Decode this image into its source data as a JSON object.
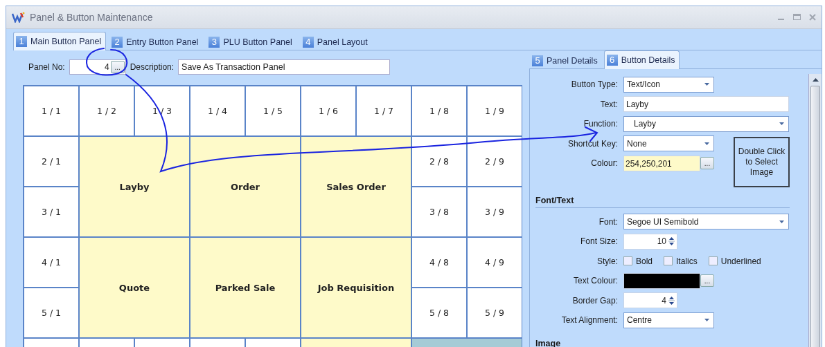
{
  "window": {
    "title": "Panel & Button Maintenance"
  },
  "tabs": [
    {
      "number": "1",
      "label": "Main Button Panel",
      "selected": true
    },
    {
      "number": "2",
      "label": "Entry Button Panel",
      "selected": false
    },
    {
      "number": "3",
      "label": "PLU Button Panel",
      "selected": false
    },
    {
      "number": "4",
      "label": "Panel Layout",
      "selected": false
    }
  ],
  "panel_no": {
    "label": "Panel No:",
    "value": "4",
    "browse": "..."
  },
  "description": {
    "label": "Description:",
    "value": "Save As Transaction Panel"
  },
  "grid": [
    {
      "label": "1 / 1",
      "kind": "single",
      "color": "#ffffff"
    },
    {
      "label": "1 / 2",
      "kind": "single",
      "color": "#ffffff"
    },
    {
      "label": "1 / 3",
      "kind": "single",
      "color": "#ffffff"
    },
    {
      "label": "1 / 4",
      "kind": "single",
      "color": "#ffffff"
    },
    {
      "label": "1 / 5",
      "kind": "single",
      "color": "#ffffff"
    },
    {
      "label": "1 / 6",
      "kind": "single",
      "color": "#ffffff"
    },
    {
      "label": "1 / 7",
      "kind": "single",
      "color": "#ffffff"
    },
    {
      "label": "1 / 8",
      "kind": "single",
      "color": "#ffffff"
    },
    {
      "label": "1 / 9",
      "kind": "single",
      "color": "#ffffff"
    },
    {
      "label": "2 / 1",
      "kind": "single",
      "color": "#ffffff"
    },
    {
      "label": "Layby",
      "kind": "double",
      "color": "#fefac9"
    },
    {
      "label": "Order",
      "kind": "double",
      "color": "#fefac9"
    },
    {
      "label": "Sales Order",
      "kind": "double",
      "color": "#fefac9"
    },
    {
      "label": "2 / 8",
      "kind": "single",
      "color": "#ffffff"
    },
    {
      "label": "2 / 9",
      "kind": "single",
      "color": "#ffffff"
    },
    {
      "label": "3 / 1",
      "kind": "single",
      "color": "#ffffff"
    },
    {
      "label": "3 / 8",
      "kind": "single",
      "color": "#ffffff"
    },
    {
      "label": "3 / 9",
      "kind": "single",
      "color": "#ffffff"
    },
    {
      "label": "4 / 1",
      "kind": "single",
      "color": "#ffffff"
    },
    {
      "label": "Quote",
      "kind": "double",
      "color": "#fefac9"
    },
    {
      "label": "Parked Sale",
      "kind": "double",
      "color": "#fefac9"
    },
    {
      "label": "Job Requisition",
      "kind": "double",
      "color": "#fefac9"
    },
    {
      "label": "4 / 8",
      "kind": "single",
      "color": "#ffffff"
    },
    {
      "label": "4 / 9",
      "kind": "single",
      "color": "#ffffff"
    },
    {
      "label": "5 / 1",
      "kind": "single",
      "color": "#ffffff"
    },
    {
      "label": "5 / 8",
      "kind": "single",
      "color": "#ffffff"
    },
    {
      "label": "5 / 9",
      "kind": "single",
      "color": "#ffffff"
    },
    {
      "kind": "single",
      "color": "#ffffff"
    },
    {
      "kind": "single",
      "color": "#ffffff"
    },
    {
      "kind": "single",
      "color": "#ffffff"
    },
    {
      "kind": "single",
      "color": "#ffffff"
    },
    {
      "kind": "single",
      "color": "#ffffff"
    },
    {
      "kind": "wide",
      "color": "#fefac9"
    },
    {
      "kind": "wide",
      "color": "#a6cbd6"
    }
  ],
  "side_tabs": [
    {
      "number": "5",
      "label": "Panel Details",
      "selected": false
    },
    {
      "number": "6",
      "label": "Button Details",
      "selected": true
    }
  ],
  "fields": [
    {
      "kind": "dropdown",
      "label": "Button Type:",
      "value": "Text/Icon"
    },
    {
      "kind": "text",
      "label": "Text:",
      "value": "Layby"
    },
    {
      "kind": "wide-dropdown",
      "label": "Function:",
      "value": "Layby"
    }
  ],
  "side_fields": [
    {
      "kind": "dropdown",
      "label": "Shortcut Key:",
      "value": "None"
    },
    {
      "kind": "colour",
      "label": "Colour:",
      "value": "254,250,201",
      "browse": "..."
    }
  ],
  "image_box": "Double Click to Select Image",
  "font_section": {
    "title": "Font/Text",
    "fields": [
      {
        "kind": "wide-dropdown",
        "label": "Font:",
        "value": "Segoe UI Semibold"
      },
      {
        "kind": "spinner",
        "label": "Font Size:",
        "value": "10"
      },
      {
        "kind": "checkboxes",
        "label": "Style:",
        "options": [
          {
            "label": "Bold",
            "checked": false
          },
          {
            "label": "Italics",
            "checked": false
          },
          {
            "label": "Underlined",
            "checked": false
          }
        ]
      },
      {
        "kind": "swatch",
        "label": "Text Colour:",
        "color": "#000000",
        "browse": "..."
      },
      {
        "kind": "spinner",
        "label": "Border Gap:",
        "value": "4"
      },
      {
        "kind": "dropdown",
        "label": "Text Alignment:",
        "value": "Centre"
      }
    ]
  },
  "image_section": {
    "title": "Image"
  }
}
